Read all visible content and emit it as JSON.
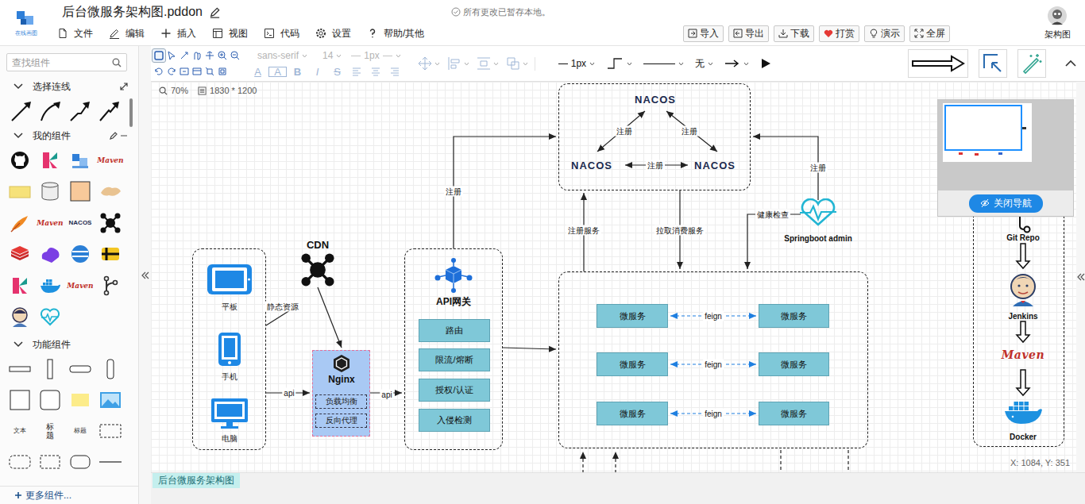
{
  "window": {
    "title": "后台微服务架构图.pddon"
  },
  "logo": {
    "caption": "在线画图"
  },
  "save_status": "所有更改已暂存本地。",
  "menu": [
    {
      "label": "文件"
    },
    {
      "label": "编辑"
    },
    {
      "label": "插入"
    },
    {
      "label": "视图"
    },
    {
      "label": "代码"
    },
    {
      "label": "设置"
    },
    {
      "label": "帮助/其他"
    }
  ],
  "actions": [
    {
      "label": "导入"
    },
    {
      "label": "导出"
    },
    {
      "label": "下载"
    },
    {
      "label": "打赏"
    },
    {
      "label": "演示"
    },
    {
      "label": "全屏"
    }
  ],
  "user": {
    "name": "架构图"
  },
  "toolbar": {
    "font_family": {
      "value": "sans-serif",
      "disabled": true
    },
    "font_size": {
      "value": "14",
      "disabled": true
    },
    "text_stroke": {
      "value": "1px",
      "disabled": true
    },
    "format": [
      {
        "label": "A",
        "disabled": true
      },
      {
        "label": "A",
        "disabled": true
      },
      {
        "label": "B",
        "disabled": true
      },
      {
        "label": "I",
        "disabled": true
      },
      {
        "label": "S",
        "disabled": true
      }
    ],
    "line_width": {
      "value": "1px",
      "disabled": false
    },
    "arrow_start": {
      "value": "无",
      "disabled": false
    }
  },
  "sidebar": {
    "search": {
      "placeholder": "查找组件"
    },
    "sections": [
      {
        "title": "选择连线",
        "expanded": true
      },
      {
        "title": "我的组件",
        "expanded": true
      },
      {
        "title": "功能组件",
        "expanded": true
      }
    ],
    "more": "更多组件..."
  },
  "my_components": [
    {
      "kind": "github"
    },
    {
      "kind": "kafka"
    },
    {
      "kind": "logo"
    },
    {
      "kind": "maven",
      "label": "Maven"
    },
    {
      "kind": "note"
    },
    {
      "kind": "cylinder"
    },
    {
      "kind": "square"
    },
    {
      "kind": "hands"
    },
    {
      "kind": "feather"
    },
    {
      "kind": "maven",
      "label": "Maven"
    },
    {
      "kind": "nacos",
      "label": "NACOS"
    },
    {
      "kind": "network"
    },
    {
      "kind": "redis"
    },
    {
      "kind": "cloud"
    },
    {
      "kind": "sphere"
    },
    {
      "kind": "pulsar"
    },
    {
      "kind": "kafka"
    },
    {
      "kind": "docker"
    },
    {
      "kind": "maven",
      "label": "Maven"
    },
    {
      "kind": "gitbranch"
    },
    {
      "kind": "jenkins"
    },
    {
      "kind": "heart"
    }
  ],
  "shape_components": [
    {
      "kind": "bar-h"
    },
    {
      "kind": "bar-v"
    },
    {
      "kind": "pill-h"
    },
    {
      "kind": "pill-v"
    },
    {
      "kind": "square"
    },
    {
      "kind": "rounded"
    },
    {
      "kind": "note"
    },
    {
      "kind": "image"
    },
    {
      "kind": "text",
      "label": "文本"
    },
    {
      "kind": "title",
      "label": "标题"
    },
    {
      "kind": "heading",
      "label": "标题"
    },
    {
      "kind": "dashed-rect"
    },
    {
      "kind": "dashed-rounded"
    },
    {
      "kind": "dashed-square"
    },
    {
      "kind": "dashed-pill"
    },
    {
      "kind": "line"
    }
  ],
  "canvas": {
    "zoom": "70%",
    "size": "1830 * 1200",
    "cursor": "X: 1084, Y: 351"
  },
  "navigator": {
    "button": "关闭导航"
  },
  "page_tabs": [
    {
      "label": "后台微服务架构图",
      "selected": true
    }
  ],
  "diagram": {
    "nacos": [
      {
        "label": "NACOS"
      },
      {
        "label": "NACOS"
      },
      {
        "label": "NACOS"
      }
    ],
    "clients": [
      {
        "label": "平板"
      },
      {
        "label": "手机"
      },
      {
        "label": "电脑"
      }
    ],
    "cdn": {
      "label": "CDN"
    },
    "nginx": {
      "label": "Nginx",
      "features": [
        "负载均衡",
        "反向代理"
      ]
    },
    "gateway": {
      "label": "API网关",
      "features": [
        "路由",
        "限流/熔断",
        "授权/认证",
        "入侵检测"
      ]
    },
    "services": [
      {
        "left": "微服务",
        "right": "微服务",
        "link": "feign"
      },
      {
        "left": "微服务",
        "right": "微服务",
        "link": "feign"
      },
      {
        "left": "微服务",
        "right": "微服务",
        "link": "feign"
      }
    ],
    "admin": {
      "label": "Springboot admin"
    },
    "pipeline": [
      {
        "label": "Git Repo",
        "kind": "git"
      },
      {
        "label": "Jenkins",
        "kind": "jenkins"
      },
      {
        "label": "Maven",
        "kind": "maven"
      },
      {
        "label": "Docker",
        "kind": "docker"
      }
    ],
    "edges": [
      {
        "label": "注册"
      },
      {
        "label": "注册"
      },
      {
        "label": "注册"
      },
      {
        "label": "注册"
      },
      {
        "label": "注册服务"
      },
      {
        "label": "拉取消费服务"
      },
      {
        "label": "注册"
      },
      {
        "label": "健康检查"
      },
      {
        "label": "静态资源"
      },
      {
        "label": "api"
      },
      {
        "label": "api"
      }
    ]
  }
}
